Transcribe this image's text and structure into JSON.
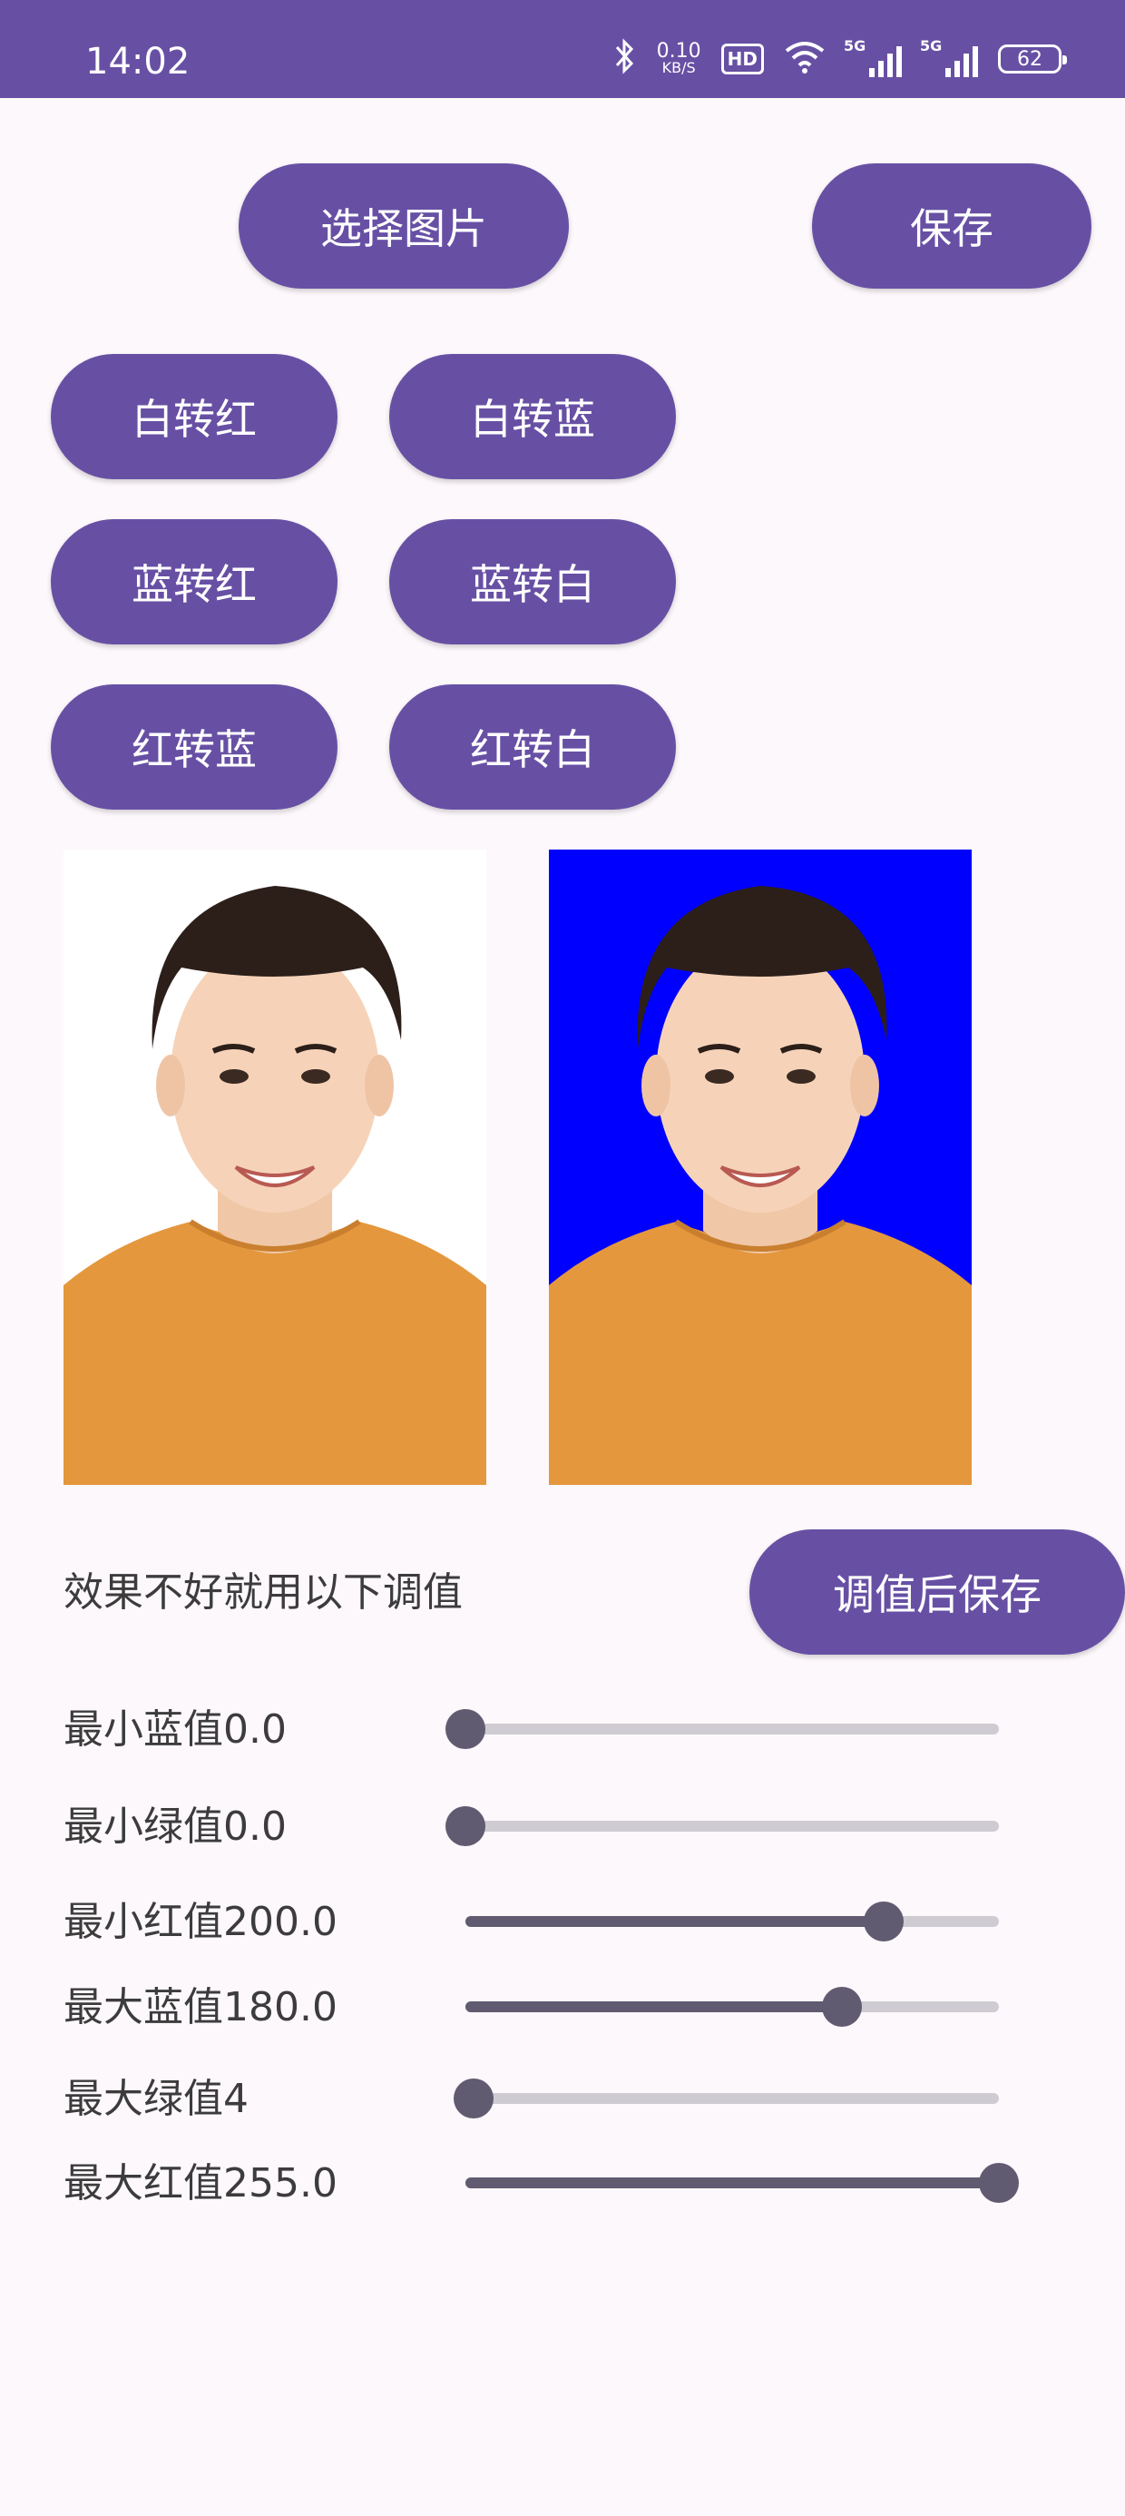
{
  "status_bar": {
    "time": "14:02",
    "net_speed_value": "0.10",
    "net_speed_unit": "KB/S",
    "hd_label": "HD",
    "signal1_label": "5G",
    "signal2_label": "5G",
    "battery": "62",
    "icons": [
      "bluetooth-icon",
      "hd-icon",
      "wifi-icon",
      "signal-icon",
      "signal-icon",
      "battery-icon"
    ]
  },
  "toolbar": {
    "select_image": "选择图片",
    "save": "保存"
  },
  "convert_buttons": {
    "white_to_red": "白转红",
    "white_to_blue": "白转蓝",
    "blue_to_red": "蓝转红",
    "blue_to_white": "蓝转白",
    "red_to_blue": "红转蓝",
    "red_to_white": "红转白"
  },
  "images": {
    "original_background": "#ffffff",
    "result_background": "#0000ff"
  },
  "adjust": {
    "hint": "效果不好就用以下调值",
    "save_after_adjust": "调值后保存"
  },
  "sliders": [
    {
      "label": "最小蓝值0.0",
      "value": 0.0,
      "max": 255
    },
    {
      "label": "最小绿值0.0",
      "value": 0.0,
      "max": 255
    },
    {
      "label": "最小红值200.0",
      "value": 200.0,
      "max": 255
    },
    {
      "label": "最大蓝值180.0",
      "value": 180.0,
      "max": 255
    },
    {
      "label": "最大绿值4",
      "value": 4,
      "max": 255
    },
    {
      "label": "最大红值255.0",
      "value": 255.0,
      "max": 255
    }
  ],
  "colors": {
    "accent": "#6750a4",
    "slider_active": "#615b71",
    "slider_inactive": "#cfcbd2",
    "background": "#fdf8fc"
  }
}
